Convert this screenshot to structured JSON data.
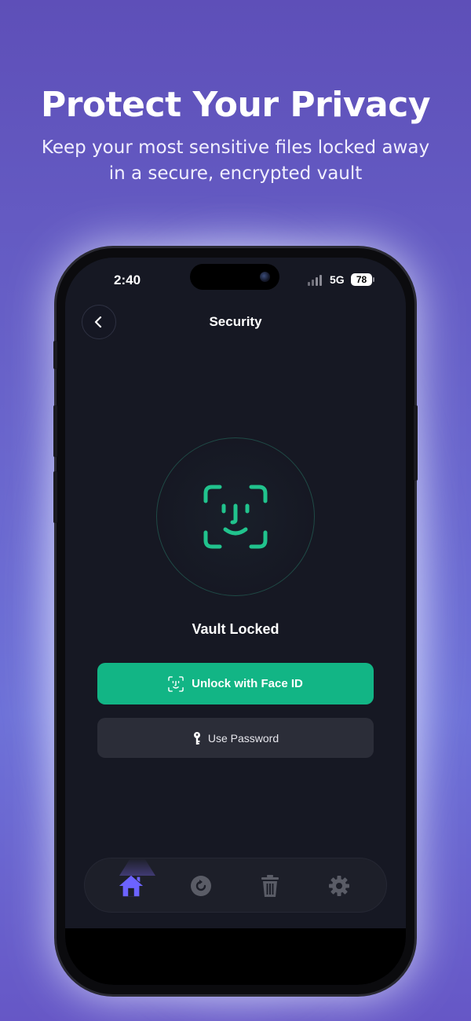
{
  "promo": {
    "title": "Protect Your Privacy",
    "subtitle": "Keep your most sensitive files locked away in a secure, encrypted vault"
  },
  "status_bar": {
    "time": "2:40",
    "network": "5G",
    "battery": "78"
  },
  "nav": {
    "title": "Security",
    "back_icon": "chevron-left-icon"
  },
  "vault": {
    "status": "Vault Locked",
    "icon": "face-id-icon",
    "unlock_label": "Unlock with Face ID",
    "password_label": "Use Password"
  },
  "tabs": [
    {
      "icon": "home-icon",
      "active": true
    },
    {
      "icon": "restore-icon",
      "active": false
    },
    {
      "icon": "trash-icon",
      "active": false
    },
    {
      "icon": "gear-icon",
      "active": false
    }
  ],
  "colors": {
    "accent_green": "#12b585",
    "face_id_green": "#21c38d",
    "active_tab": "#6c63ff",
    "inactive_tab": "#5a5c66",
    "screen_bg": "#161823",
    "page_bg": "#5e4fb8"
  }
}
